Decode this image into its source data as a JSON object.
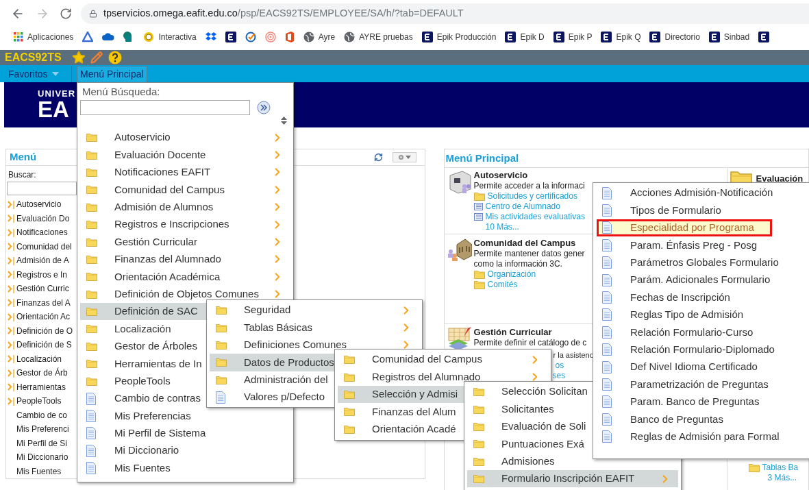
{
  "browser": {
    "url_host": "tpservicios.omega.eafit.edu.co",
    "url_path": "/psp/EACS92TS/EMPLOYEE/SA/h/?tab=DEFAULT",
    "bookmarks": [
      {
        "kind": "apps",
        "label": "Aplicaciones"
      },
      {
        "kind": "triangle"
      },
      {
        "kind": "cloud"
      },
      {
        "kind": "tile-green"
      },
      {
        "kind": "badge",
        "label": "Interactiva"
      },
      {
        "kind": "dropbox"
      },
      {
        "kind": "tile"
      },
      {
        "kind": "check"
      },
      {
        "kind": "target"
      },
      {
        "kind": "office"
      },
      {
        "kind": "globe",
        "label": "Ayre"
      },
      {
        "kind": "globe",
        "label": "AYRE pruebas"
      },
      {
        "kind": "tile",
        "label": "Epik Producción"
      },
      {
        "kind": "tile",
        "label": "Epik D"
      },
      {
        "kind": "tile",
        "label": "Epik P"
      },
      {
        "kind": "tile",
        "label": "Epik Q"
      },
      {
        "kind": "tile",
        "label": "Directorio"
      },
      {
        "kind": "tile",
        "label": "Sinbad"
      },
      {
        "kind": "tile"
      }
    ]
  },
  "header": {
    "title": "EACS92TS"
  },
  "nav": {
    "tabs": [
      {
        "label": "Favoritos",
        "kind": "dropdown",
        "selected": false
      },
      {
        "label": "Menú Principal",
        "kind": "tab",
        "selected": true
      }
    ]
  },
  "banner": {
    "logo_lines": [
      "UNIVER",
      "EA"
    ]
  },
  "left_panel": {
    "title": "Menú",
    "search_label": "Buscar:",
    "items": [
      {
        "label": "Autoservicio",
        "kind": "folder"
      },
      {
        "label": "Evaluación Do",
        "kind": "folder"
      },
      {
        "label": "Notificaciones",
        "kind": "folder"
      },
      {
        "label": "Comunidad del",
        "kind": "folder"
      },
      {
        "label": "Admisión de A",
        "kind": "folder"
      },
      {
        "label": "Registros e In",
        "kind": "folder"
      },
      {
        "label": "Gestión Curric",
        "kind": "folder"
      },
      {
        "label": "Finanzas del A",
        "kind": "folder"
      },
      {
        "label": "Orientación Ac",
        "kind": "folder"
      },
      {
        "label": "Definición de O",
        "kind": "folder"
      },
      {
        "label": "Definición de S",
        "kind": "folder"
      },
      {
        "label": "Localización",
        "kind": "folder"
      },
      {
        "label": "Gestor de Árb",
        "kind": "folder"
      },
      {
        "label": "Herramientas",
        "kind": "folder"
      },
      {
        "label": "PeopleTools",
        "kind": "folder"
      },
      {
        "label": "Cambio de co",
        "kind": "page"
      },
      {
        "label": "Mis Preferenci",
        "kind": "page"
      },
      {
        "label": "Mi Perfil de Si",
        "kind": "page"
      },
      {
        "label": "Mi Diccionario",
        "kind": "page"
      },
      {
        "label": "Mis Fuentes",
        "kind": "page"
      }
    ]
  },
  "main_panel": {
    "title": "Menú Principal",
    "sections": [
      {
        "title": "Autoservicio",
        "kind": "kiosk",
        "description": [
          "Permite acceder a la informaci"
        ],
        "links": [
          {
            "label": "Solicitudes y certificados",
            "kind": "folder"
          },
          {
            "label": "Centro de Alumnado",
            "kind": "list"
          },
          {
            "label": "Mis actividades evaluativas",
            "kind": "list"
          },
          {
            "label": "10 Más...",
            "kind": "more"
          }
        ]
      },
      {
        "title": "Comunidad del Campus",
        "kind": "building",
        "description": [
          "Permite mantener datos gener",
          "como la información 3C."
        ],
        "links": [
          {
            "label": "Organización",
            "kind": "folder"
          },
          {
            "label": "Comités",
            "kind": "folder"
          }
        ]
      },
      {
        "title": "Gestión Curricular",
        "kind": "books",
        "description": [
          "Permite definir el catálogo de c"
        ],
        "fragments": [
          {
            "label": "r la asistenc",
            "kind": "text"
          },
          {
            "label": "os",
            "kind": "link"
          },
          {
            "label": "ses",
            "kind": "link"
          }
        ]
      }
    ],
    "side": {
      "title": "Evaluación",
      "links": [
        {
          "label": "Tablas Ba",
          "kind": "folder"
        },
        {
          "label": "3 Más...",
          "kind": "more"
        }
      ]
    }
  },
  "menus": [
    {
      "search_label": "Menú Búsqueda:",
      "items": [
        {
          "label": "Autoservicio",
          "kind": "folder",
          "arrow": true,
          "selected": false
        },
        {
          "label": "Evaluación Docente",
          "kind": "folder",
          "arrow": true,
          "selected": false
        },
        {
          "label": "Notificaciones EAFIT",
          "kind": "folder",
          "arrow": true,
          "selected": false
        },
        {
          "label": "Comunidad del Campus",
          "kind": "folder",
          "arrow": true,
          "selected": false
        },
        {
          "label": "Admisión de Alumnos",
          "kind": "folder",
          "arrow": true,
          "selected": false
        },
        {
          "label": "Registros e Inscripciones",
          "kind": "folder",
          "arrow": true,
          "selected": false
        },
        {
          "label": "Gestión Curricular",
          "kind": "folder",
          "arrow": true,
          "selected": false
        },
        {
          "label": "Finanzas del Alumnado",
          "kind": "folder",
          "arrow": true,
          "selected": false
        },
        {
          "label": "Orientación Académica",
          "kind": "folder",
          "arrow": true,
          "selected": false
        },
        {
          "label": "Definición de Objetos Comunes",
          "kind": "folder",
          "arrow": true,
          "selected": false
        },
        {
          "label": "Definición de SAC",
          "kind": "folder",
          "arrow": false,
          "selected": true
        },
        {
          "label": "Localización",
          "kind": "folder",
          "arrow": false,
          "selected": false
        },
        {
          "label": "Gestor de Árboles",
          "kind": "folder",
          "arrow": false,
          "selected": false
        },
        {
          "label": "Herramientas de In",
          "kind": "folder",
          "arrow": false,
          "selected": false
        },
        {
          "label": "PeopleTools",
          "kind": "folder",
          "arrow": false,
          "selected": false
        },
        {
          "label": "Cambio de contras",
          "kind": "page",
          "arrow": false,
          "selected": false
        },
        {
          "label": "Mis Preferencias",
          "kind": "page",
          "arrow": false,
          "selected": false
        },
        {
          "label": "Mi Perfil de Sistema",
          "kind": "page",
          "arrow": false,
          "selected": false
        },
        {
          "label": "Mi Diccionario",
          "kind": "page",
          "arrow": false,
          "selected": false
        },
        {
          "label": "Mis Fuentes",
          "kind": "page",
          "arrow": false,
          "selected": false
        }
      ]
    },
    {
      "items": [
        {
          "label": "Seguridad",
          "kind": "folder",
          "arrow": true,
          "selected": false
        },
        {
          "label": "Tablas Básicas",
          "kind": "folder",
          "arrow": true,
          "selected": false
        },
        {
          "label": "Definiciones Comunes",
          "kind": "folder",
          "arrow": true,
          "selected": false
        },
        {
          "label": "Datos de Productos",
          "kind": "folder",
          "arrow": false,
          "selected": true
        },
        {
          "label": "Administración del",
          "kind": "folder",
          "arrow": false,
          "selected": false
        },
        {
          "label": "Valores p/Defecto",
          "kind": "page",
          "arrow": false,
          "selected": false
        }
      ]
    },
    {
      "items": [
        {
          "label": "Comunidad del Campus",
          "kind": "folder",
          "arrow": true,
          "selected": false
        },
        {
          "label": "Registros del Alumnado",
          "kind": "folder",
          "arrow": true,
          "selected": false
        },
        {
          "label": "Selección y Admisi",
          "kind": "folder",
          "arrow": false,
          "selected": true
        },
        {
          "label": "Finanzas del Alum",
          "kind": "folder",
          "arrow": false,
          "selected": false
        },
        {
          "label": "Orientación Acadé",
          "kind": "folder",
          "arrow": false,
          "selected": false
        }
      ]
    },
    {
      "items": [
        {
          "label": "Selección Solicitan",
          "kind": "folder",
          "arrow": false,
          "selected": false
        },
        {
          "label": "Solicitantes",
          "kind": "folder",
          "arrow": false,
          "selected": false
        },
        {
          "label": "Evaluación de Soli",
          "kind": "folder",
          "arrow": false,
          "selected": false
        },
        {
          "label": "Puntuaciones Exá",
          "kind": "folder",
          "arrow": false,
          "selected": false
        },
        {
          "label": "Admisiones",
          "kind": "folder",
          "arrow": false,
          "selected": false
        },
        {
          "label": "Formulario Inscripción EAFIT",
          "kind": "folder",
          "arrow": true,
          "selected": true
        }
      ]
    },
    {
      "items": [
        {
          "label": "Acciones Admisión-Notificación",
          "kind": "page",
          "arrow": false,
          "selected": false
        },
        {
          "label": "Tipos de Formulario",
          "kind": "page",
          "arrow": false,
          "selected": false
        },
        {
          "label": "Especialidad por Programa",
          "kind": "page",
          "arrow": false,
          "selected": true
        },
        {
          "label": "Param. Énfasis Preg - Posg",
          "kind": "page",
          "arrow": false,
          "selected": false
        },
        {
          "label": "Parámetros Globales Formulario",
          "kind": "page",
          "arrow": false,
          "selected": false
        },
        {
          "label": "Parám. Adicionales Formulario",
          "kind": "page",
          "arrow": false,
          "selected": false
        },
        {
          "label": "Fechas de Inscripción",
          "kind": "page",
          "arrow": false,
          "selected": false
        },
        {
          "label": "Reglas Tipo de Admisión",
          "kind": "page",
          "arrow": false,
          "selected": false
        },
        {
          "label": "Relación Formulario-Curso",
          "kind": "page",
          "arrow": false,
          "selected": false
        },
        {
          "label": "Relación Formulario-Diplomado",
          "kind": "page",
          "arrow": false,
          "selected": false
        },
        {
          "label": "Def Nivel Idioma Certificado",
          "kind": "page",
          "arrow": false,
          "selected": false
        },
        {
          "label": "Parametrización de Preguntas",
          "kind": "page",
          "arrow": false,
          "selected": false
        },
        {
          "label": "Param. Banco de Preguntas",
          "kind": "page",
          "arrow": false,
          "selected": false
        },
        {
          "label": "Banco de Preguntas",
          "kind": "page",
          "arrow": false,
          "selected": false
        },
        {
          "label": "Reglas de Admisión para Formal",
          "kind": "page",
          "arrow": false,
          "selected": false
        }
      ]
    }
  ]
}
